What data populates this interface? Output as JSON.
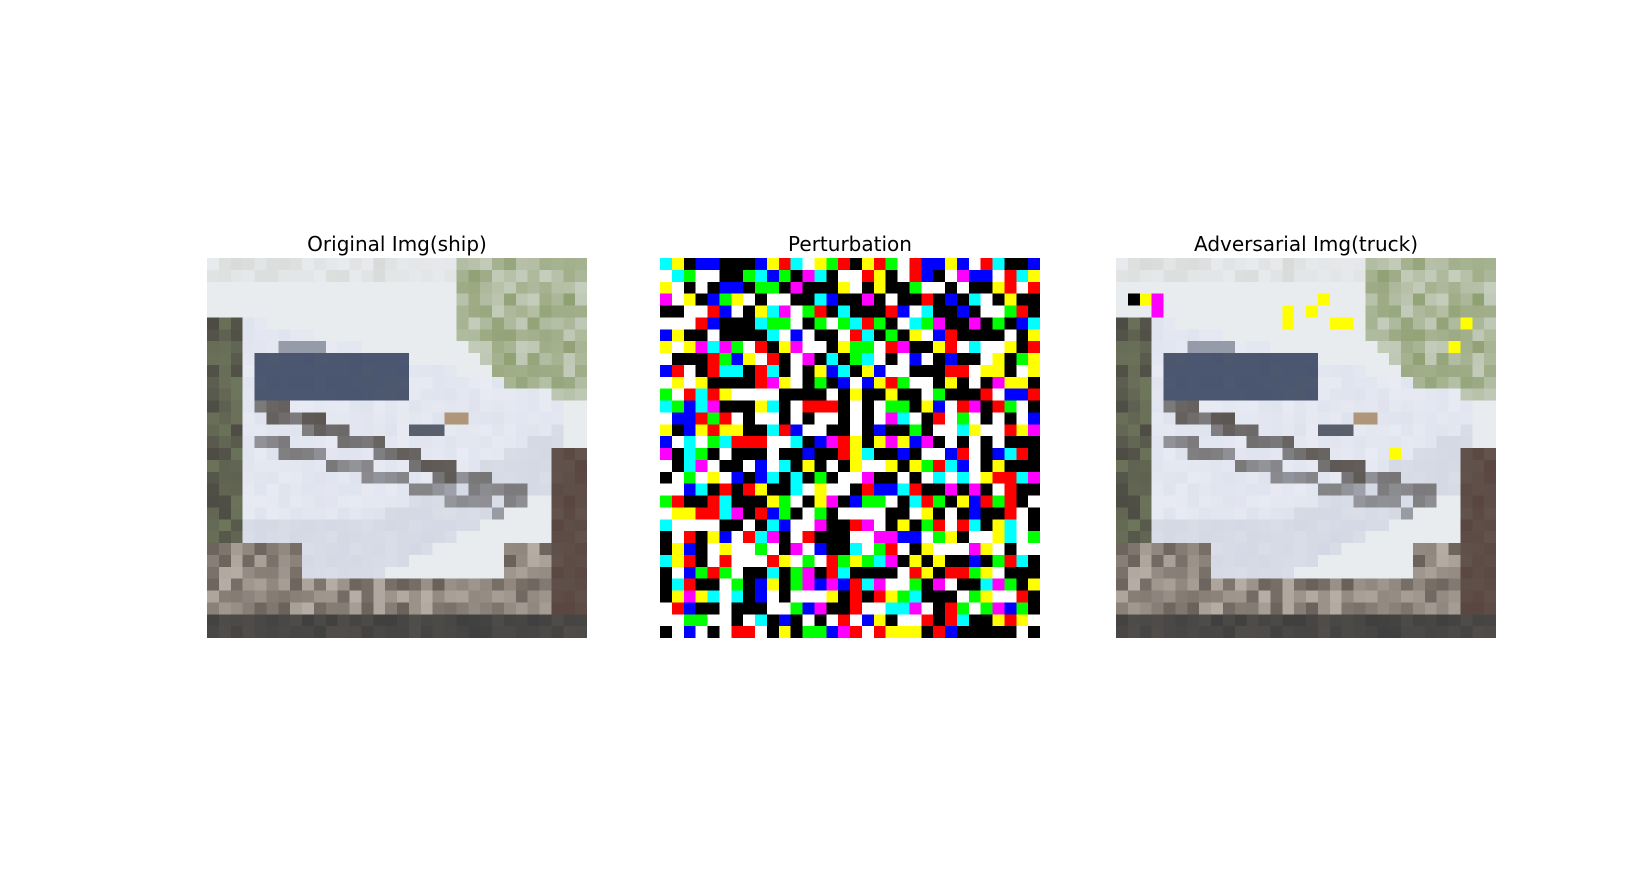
{
  "figure": {
    "panels": [
      {
        "id": "original",
        "title": "Original Img(ship)"
      },
      {
        "id": "perturbation",
        "title": "Perturbation"
      },
      {
        "id": "adversarial",
        "title": "Adversarial Img(truck)"
      }
    ]
  },
  "image": {
    "grid": 32,
    "background_color": "#ffffff",
    "scene_colors": {
      "sky": "#e9ecef",
      "foliage": "#8fa072",
      "dark_trees": "#4c4a44",
      "hull": "#dfe3ee",
      "hull_shadow": "#b9bfcd",
      "cabin_window": "#4a5670",
      "deck_stripe": "#5b5550",
      "ground": "#6a625a",
      "ground_light": "#b8b0a6",
      "bottom_band": "#3f3f3f"
    },
    "perturbation_palette": [
      "#000000",
      "#ffffff",
      "#ff0000",
      "#00ff00",
      "#0000ff",
      "#00ffff",
      "#ff00ff",
      "#ffff00"
    ]
  }
}
